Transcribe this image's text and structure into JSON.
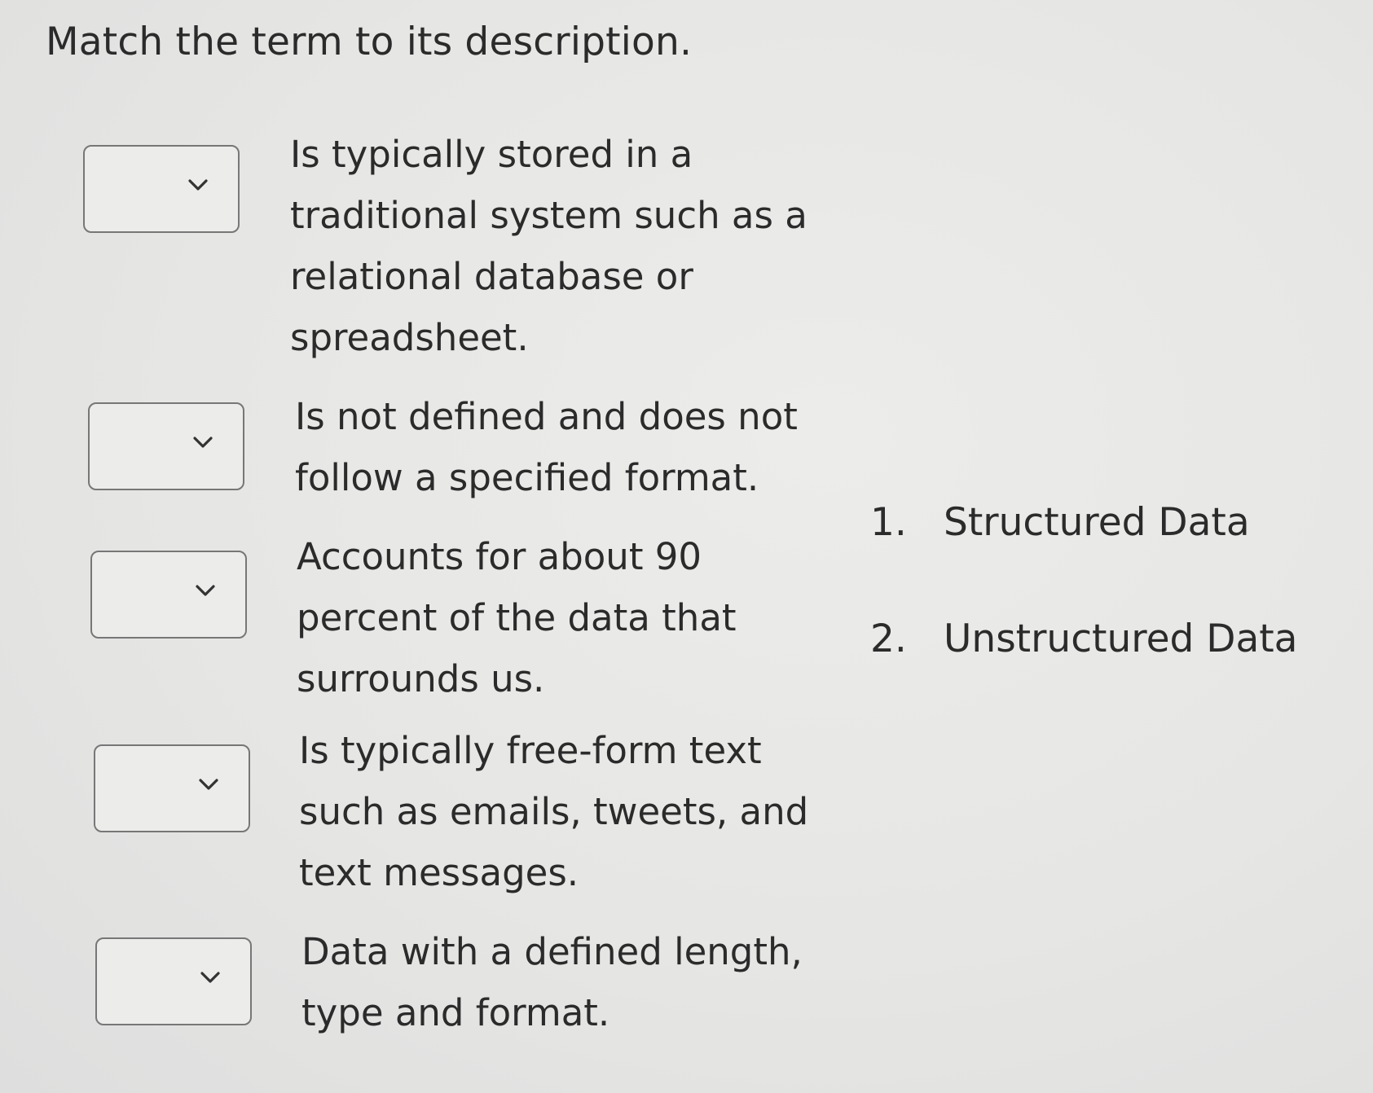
{
  "prompt": "Match the term to its description.",
  "matches": [
    {
      "selected": "",
      "description_lines": [
        "Is typically stored in a",
        "traditional system such as a",
        "relational database or",
        "spreadsheet."
      ]
    },
    {
      "selected": "",
      "description_lines": [
        "Is not defined and does not",
        "follow a specified format."
      ]
    },
    {
      "selected": "",
      "description_lines": [
        "Accounts for about 90",
        "percent of the data that",
        "surrounds us."
      ]
    },
    {
      "selected": "",
      "description_lines": [
        "Is typically free-form text",
        "such as emails, tweets, and",
        "text messages."
      ]
    },
    {
      "selected": "",
      "description_lines": [
        "Data with a defined length,",
        "type and format."
      ]
    }
  ],
  "options": [
    {
      "number": "1.",
      "label": "Structured Data"
    },
    {
      "number": "2.",
      "label": "Unstructured Data"
    }
  ],
  "icons": {
    "dropdown": "chevron-down-icon"
  },
  "colors": {
    "background": "#e7e7e5",
    "text": "#2b2b2b",
    "select_border": "#777777"
  }
}
